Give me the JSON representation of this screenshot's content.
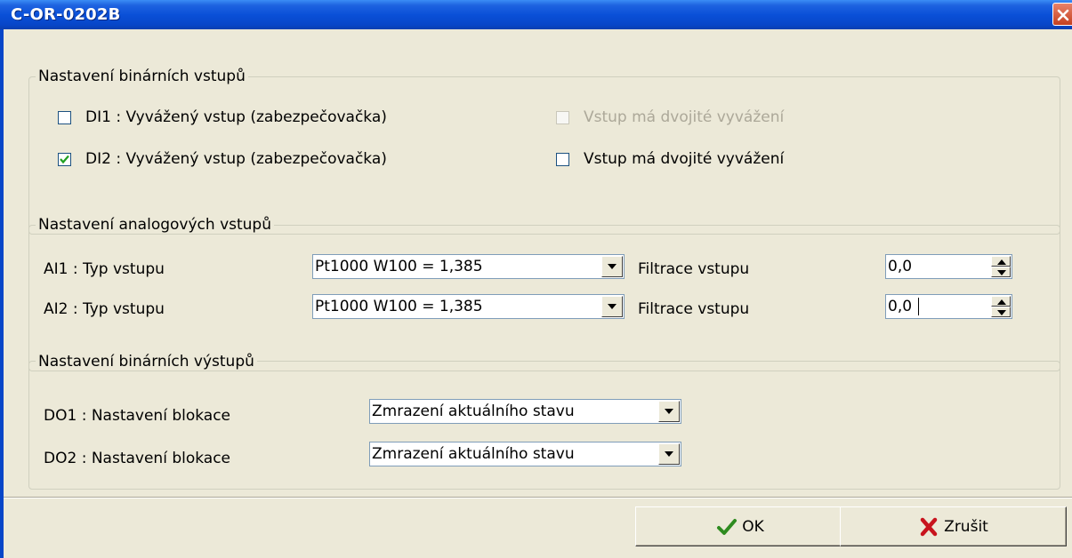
{
  "window": {
    "title": "C-OR-0202B"
  },
  "binary_inputs": {
    "legend": "Nastavení binárních vstupů",
    "rows": [
      {
        "label": "DI1 : Vyvážený vstup (zabezpečovačka)",
        "checked": false,
        "double_label": "Vstup má dvojité vyvážení",
        "double_checked": false,
        "double_enabled": false
      },
      {
        "label": "DI2 : Vyvážený vstup (zabezpečovačka)",
        "checked": true,
        "double_label": "Vstup má dvojité vyvážení",
        "double_checked": false,
        "double_enabled": true
      }
    ]
  },
  "analog_inputs": {
    "legend": "Nastavení analogových vstupů",
    "rows": [
      {
        "label": "AI1 : Typ vstupu",
        "type_value": "Pt1000 W100 = 1,385",
        "filter_label": "Filtrace vstupu",
        "filter_value": "0,0"
      },
      {
        "label": "AI2 : Typ vstupu",
        "type_value": "Pt1000 W100 = 1,385",
        "filter_label": "Filtrace vstupu",
        "filter_value": "0,0"
      }
    ]
  },
  "binary_outputs": {
    "legend": "Nastavení binárních výstupů",
    "rows": [
      {
        "label": "DO1 : Nastavení blokace",
        "value": "Zmrazení aktuálního stavu"
      },
      {
        "label": "DO2 : Nastavení blokace",
        "value": "Zmrazení aktuálního stavu"
      }
    ]
  },
  "buttons": {
    "ok": "OK",
    "cancel": "Zrušit"
  },
  "icons": {
    "ok": "checkmark-icon",
    "cancel": "red-x-icon",
    "close": "close-icon"
  },
  "colors": {
    "titlebar": "#0a50d8",
    "dialog_bg": "#ece9d8",
    "ok_icon": "#2e8b1f",
    "cancel_icon": "#c8141e"
  }
}
